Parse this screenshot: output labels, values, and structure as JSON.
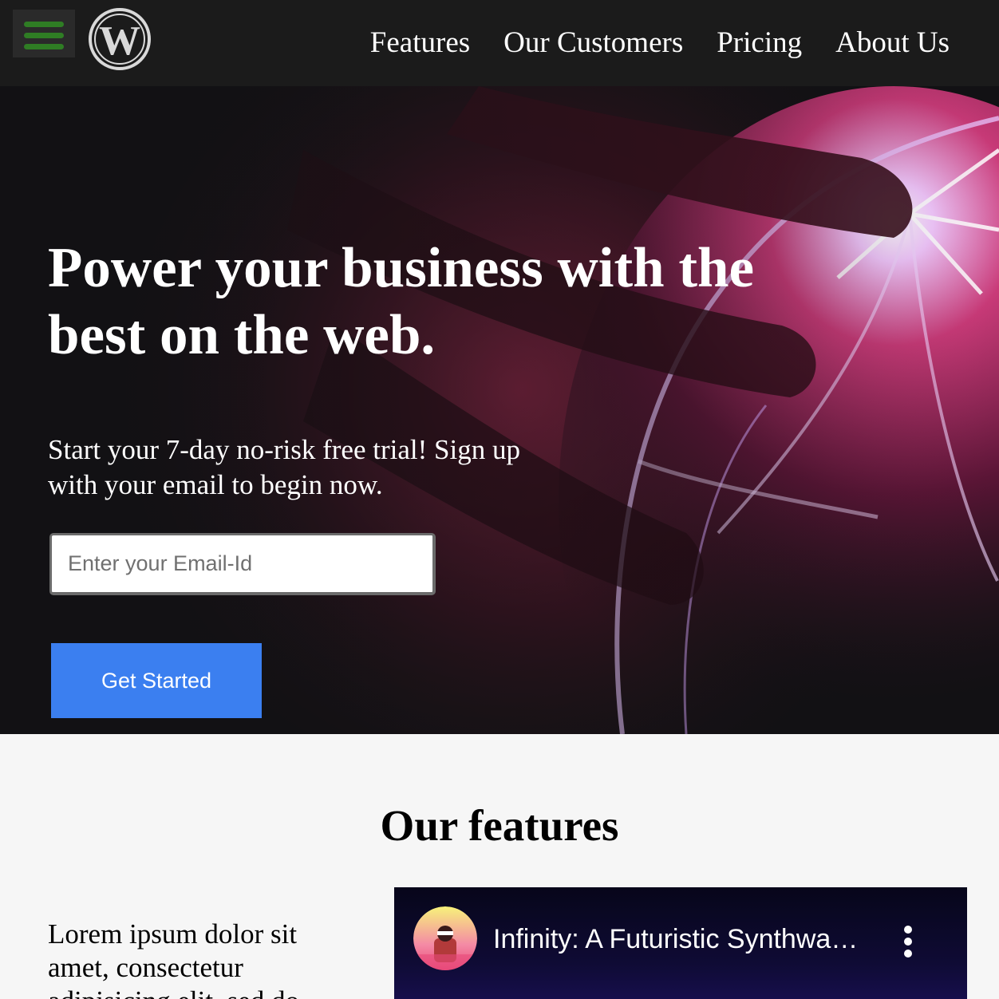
{
  "header": {
    "menu_icon": "hamburger-menu-icon",
    "logo_icon": "wordpress-logo-icon",
    "menu_color": "#2f7d24",
    "nav": [
      {
        "label": "Features"
      },
      {
        "label": "Our Customers"
      },
      {
        "label": "Pricing"
      },
      {
        "label": "About Us"
      }
    ]
  },
  "hero": {
    "title": "Power your business with the best on the web.",
    "subtitle": "Start your 7-day no-risk free trial! Sign up with your email to begin now.",
    "email_placeholder": "Enter your Email-Id",
    "cta_label": "Get Started",
    "cta_color": "#3b7ff0"
  },
  "features": {
    "title": "Our features",
    "text": "Lorem ipsum dolor sit amet, consectetur adipisicing elit, sed do",
    "video": {
      "title": "Infinity: A Futuristic Synthwave Mix",
      "menu_icon": "more-vert-icon"
    }
  }
}
